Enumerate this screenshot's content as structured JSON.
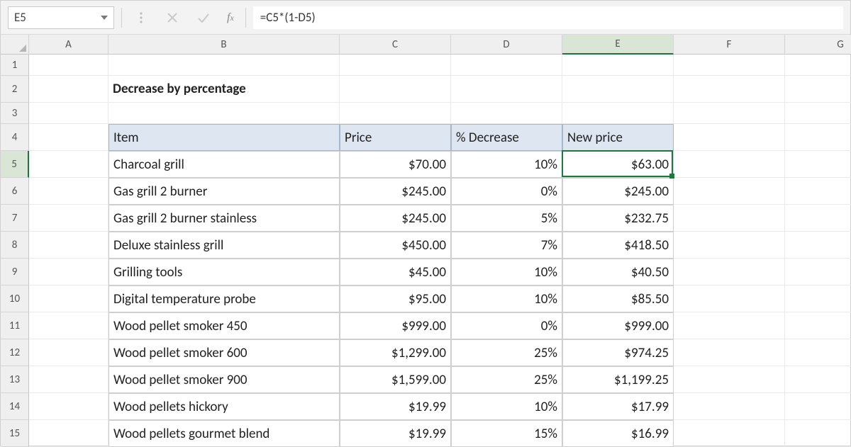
{
  "formula_bar": {
    "cell_ref": "E5",
    "formula": "=C5*(1-D5)"
  },
  "columns": [
    "A",
    "B",
    "C",
    "D",
    "E",
    "F",
    "G"
  ],
  "selected_col": "E",
  "rows": [
    1,
    2,
    3,
    4,
    5,
    6,
    7,
    8,
    9,
    10,
    11,
    12,
    13,
    14,
    15
  ],
  "selected_row": 5,
  "title_cell": "Decrease by percentage",
  "table": {
    "headers": {
      "item": "Item",
      "price": "Price",
      "pct": "% Decrease",
      "newprice": "New price"
    },
    "rows": [
      {
        "item": "Charcoal grill",
        "price": "$70.00",
        "pct": "10%",
        "newprice": "$63.00"
      },
      {
        "item": "Gas grill 2 burner",
        "price": "$245.00",
        "pct": "0%",
        "newprice": "$245.00"
      },
      {
        "item": "Gas grill 2 burner stainless",
        "price": "$245.00",
        "pct": "5%",
        "newprice": "$232.75"
      },
      {
        "item": "Deluxe stainless grill",
        "price": "$450.00",
        "pct": "7%",
        "newprice": "$418.50"
      },
      {
        "item": "Grilling tools",
        "price": "$45.00",
        "pct": "10%",
        "newprice": "$40.50"
      },
      {
        "item": "Digital temperature probe",
        "price": "$95.00",
        "pct": "10%",
        "newprice": "$85.50"
      },
      {
        "item": "Wood pellet smoker 450",
        "price": "$999.00",
        "pct": "0%",
        "newprice": "$999.00"
      },
      {
        "item": "Wood pellet smoker 600",
        "price": "$1,299.00",
        "pct": "25%",
        "newprice": "$974.25"
      },
      {
        "item": "Wood pellet smoker 900",
        "price": "$1,599.00",
        "pct": "25%",
        "newprice": "$1,199.25"
      },
      {
        "item": "Wood pellets hickory",
        "price": "$19.99",
        "pct": "10%",
        "newprice": "$17.99"
      },
      {
        "item": "Wood pellets gourmet blend",
        "price": "$19.99",
        "pct": "15%",
        "newprice": "$16.99"
      }
    ]
  }
}
